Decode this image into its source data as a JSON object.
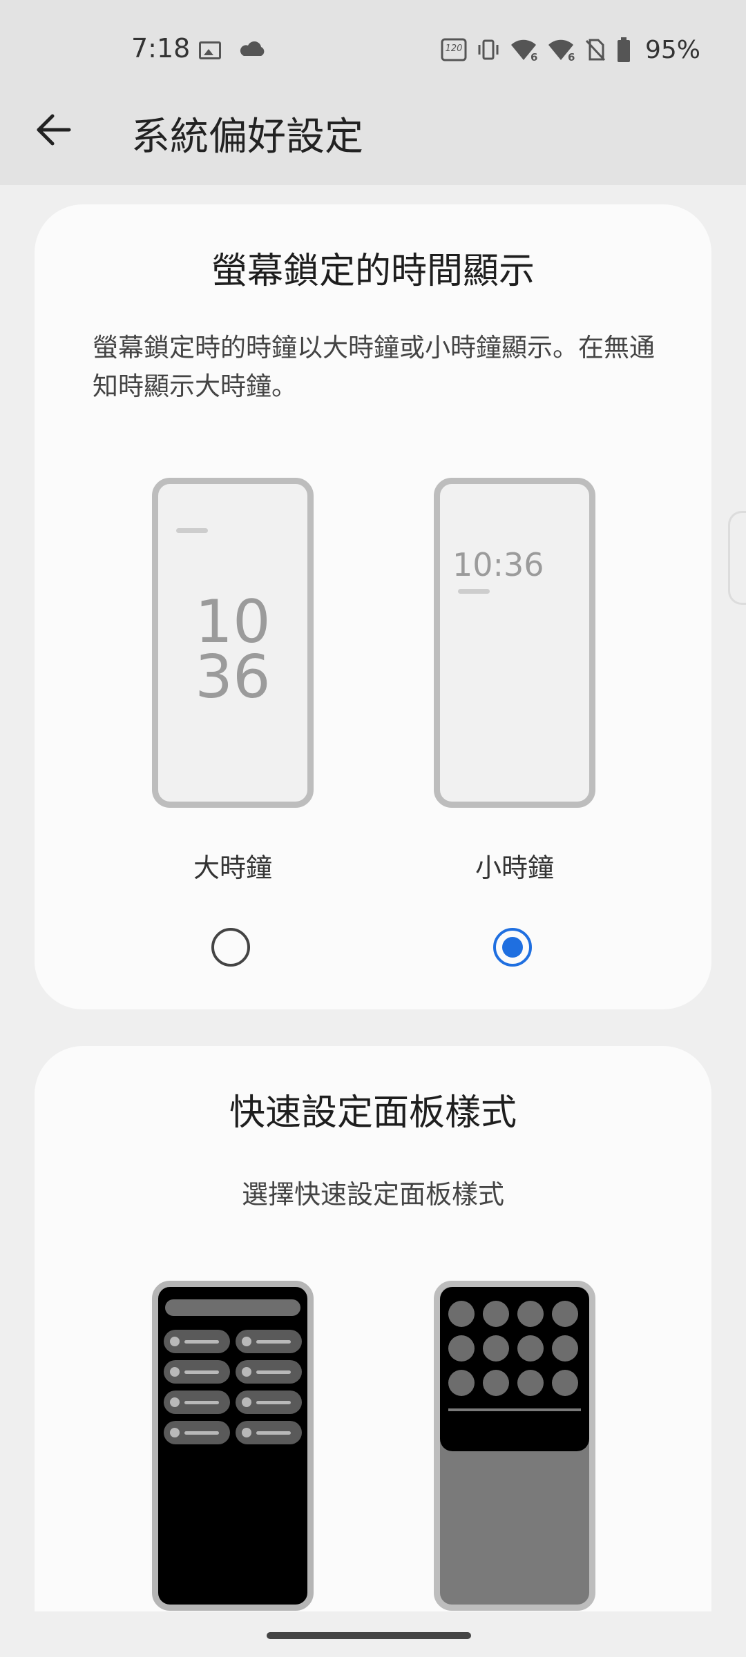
{
  "status_bar": {
    "time": "7:18",
    "left_icons": [
      "image-icon",
      "cloud-icon"
    ],
    "right_icons": [
      "refresh-rate-120hz-icon",
      "vibrate-icon",
      "wifi-6-icon",
      "wifi-6-icon",
      "no-sim-icon",
      "battery-icon"
    ],
    "refresh_rate_text": "120",
    "wifi_badge": "6",
    "battery_percent": "95%"
  },
  "app_bar": {
    "back_icon": "arrow-left-icon",
    "title": "系統偏好設定"
  },
  "lockscreen_clock": {
    "title": "螢幕鎖定的時間顯示",
    "description": "螢幕鎖定時的時鐘以大時鐘或小時鐘顯示。在無通知時顯示大時鐘。",
    "options": [
      {
        "label": "大時鐘",
        "preview_hour": "10",
        "preview_minute": "36",
        "selected": false
      },
      {
        "label": "小時鐘",
        "preview_time": "10:36",
        "selected": true
      }
    ]
  },
  "quick_settings": {
    "title": "快速設定面板樣式",
    "subtitle": "選擇快速設定面板樣式"
  },
  "colors": {
    "accent": "#1f6fe0",
    "background": "#efefef",
    "card": "#fbfbfb",
    "top_bar": "#e3e3e3"
  }
}
